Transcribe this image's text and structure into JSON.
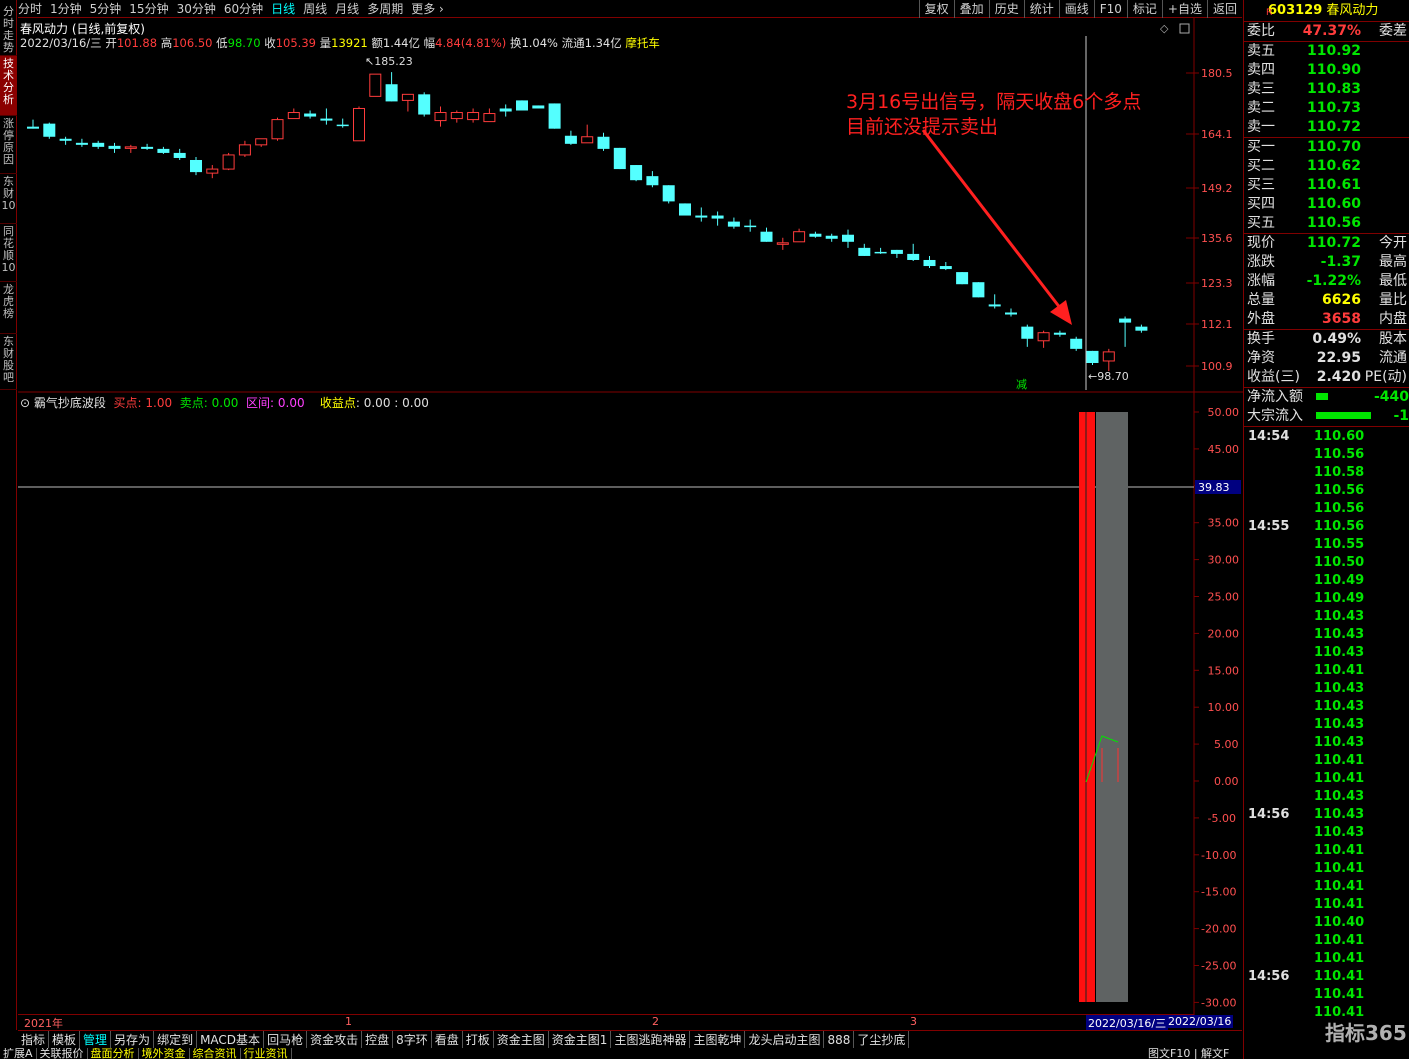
{
  "left_tabs": [
    "分时走势",
    "技术分析",
    "涨停原因",
    "东财10",
    "同花顺10",
    "龙虎榜",
    "东财股吧"
  ],
  "top_periods": [
    "分时",
    "1分钟",
    "5分钟",
    "15分钟",
    "30分钟",
    "60分钟",
    "日线",
    "周线",
    "月线",
    "多周期",
    "更多"
  ],
  "active_period": "日线",
  "top_buttons": [
    "复权",
    "叠加",
    "历史",
    "统计",
    "画线",
    "F10",
    "标记",
    "+自选",
    "返回"
  ],
  "chart_title": "春风动力 (日线,前复权)",
  "ohlc": {
    "date": "2022/03/16/三",
    "open_l": "开",
    "open": "101.88",
    "high_l": "高",
    "high": "106.50",
    "low_l": "低",
    "low": "98.70",
    "close_l": "收",
    "close": "105.39",
    "vol_l": "量",
    "vol": "13921",
    "amt_l": "额",
    "amt": "1.44亿",
    "chg_l": "幅",
    "chg": "4.84(4.81%)",
    "turn_l": "换",
    "turn": "1.04%",
    "float_l": "流通",
    "float": "1.34亿",
    "tag": "摩托车"
  },
  "price_axis": [
    "180.5",
    "164.1",
    "149.2",
    "135.6",
    "123.3",
    "112.1",
    "100.9"
  ],
  "max_label": "185.23",
  "min_label": "98.70",
  "jian": "减",
  "annotation": {
    "line1": "3月16号出信号，隔天收盘6个多点",
    "line2": "目前还没提示卖出"
  },
  "indicator": {
    "name": "霸气抄底波段",
    "buy_l": "买点",
    "buy": "1.00",
    "sell_l": "卖点",
    "sell": "0.00",
    "range_l": "区间",
    "range": "0.00",
    "profit_l": "收益点",
    "profit": "0.00 : 0.00"
  },
  "ind_axis": [
    "50.00",
    "45.00",
    "40.00",
    "35.00",
    "30.00",
    "25.00",
    "20.00",
    "15.00",
    "10.00",
    "5.00",
    "0.00",
    "-5.00",
    "-10.00",
    "-15.00",
    "-20.00",
    "-25.00",
    "-30.00"
  ],
  "ind_crosshair_value": "39.83",
  "time_axis": {
    "year": "2021年",
    "m1": "1",
    "m2": "2",
    "m3": "3",
    "date1": "2022/03/16/三",
    "date2": "2022/03/16"
  },
  "bottom_tabs": [
    "指标",
    "模板",
    "管理",
    "另存为",
    "绑定到",
    "MACD基本",
    "回马枪",
    "资金攻击",
    "控盘",
    "8字环",
    "看盘",
    "打板",
    "资金主图",
    "资金主图1",
    "主图逃跑神器",
    "主图乾坤",
    "龙头启动主图",
    "888",
    "了尘抄底"
  ],
  "bottom_tabs2": [
    "扩展A",
    "关联报价",
    "盘面分析",
    "境外资金",
    "综合资讯",
    "行业资讯"
  ],
  "bottom_right": "图文F10 | 解文F",
  "stock": {
    "code": "603129",
    "name": "春风动力",
    "badge": "R"
  },
  "quote": {
    "wb_l": "委比",
    "wb": "47.37%",
    "wc_l": "委差",
    "asks": [
      {
        "l": "卖五",
        "p": "110.92"
      },
      {
        "l": "卖四",
        "p": "110.90"
      },
      {
        "l": "卖三",
        "p": "110.83"
      },
      {
        "l": "卖二",
        "p": "110.73"
      },
      {
        "l": "卖一",
        "p": "110.72"
      }
    ],
    "bids": [
      {
        "l": "买一",
        "p": "110.70"
      },
      {
        "l": "买二",
        "p": "110.62"
      },
      {
        "l": "买三",
        "p": "110.61"
      },
      {
        "l": "买四",
        "p": "110.60"
      },
      {
        "l": "买五",
        "p": "110.56"
      }
    ],
    "stats": [
      {
        "l": "现价",
        "v": "110.72",
        "r": "今开",
        "c": "#00e600"
      },
      {
        "l": "涨跌",
        "v": "-1.37",
        "r": "最高",
        "c": "#00e600"
      },
      {
        "l": "涨幅",
        "v": "-1.22%",
        "r": "最低",
        "c": "#00e600"
      },
      {
        "l": "总量",
        "v": "6626",
        "r": "量比",
        "c": "#ffff00"
      },
      {
        "l": "外盘",
        "v": "3658",
        "r": "内盘",
        "c": "#ff3c3c"
      }
    ],
    "stats2": [
      {
        "l": "换手",
        "v": "0.49%",
        "r": "股本"
      },
      {
        "l": "净资",
        "v": "22.95",
        "r": "流通"
      },
      {
        "l": "收益(三)",
        "v": "2.420",
        "r": "PE(动)"
      }
    ],
    "flows": [
      {
        "l": "净流入额",
        "v": "-440"
      },
      {
        "l": "大宗流入",
        "v": "-1"
      }
    ]
  },
  "ticks": [
    {
      "t": "14:54",
      "p": "110.60"
    },
    {
      "t": "",
      "p": "110.56"
    },
    {
      "t": "",
      "p": "110.58"
    },
    {
      "t": "",
      "p": "110.56"
    },
    {
      "t": "",
      "p": "110.56"
    },
    {
      "t": "14:55",
      "p": "110.56"
    },
    {
      "t": "",
      "p": "110.55"
    },
    {
      "t": "",
      "p": "110.50"
    },
    {
      "t": "",
      "p": "110.49"
    },
    {
      "t": "",
      "p": "110.49"
    },
    {
      "t": "",
      "p": "110.43"
    },
    {
      "t": "",
      "p": "110.43"
    },
    {
      "t": "",
      "p": "110.43"
    },
    {
      "t": "",
      "p": "110.41"
    },
    {
      "t": "",
      "p": "110.43"
    },
    {
      "t": "",
      "p": "110.43"
    },
    {
      "t": "",
      "p": "110.43"
    },
    {
      "t": "",
      "p": "110.43"
    },
    {
      "t": "",
      "p": "110.41"
    },
    {
      "t": "",
      "p": "110.41"
    },
    {
      "t": "",
      "p": "110.43"
    },
    {
      "t": "14:56",
      "p": "110.43"
    },
    {
      "t": "",
      "p": "110.43"
    },
    {
      "t": "",
      "p": "110.41"
    },
    {
      "t": "",
      "p": "110.41"
    },
    {
      "t": "",
      "p": "110.41"
    },
    {
      "t": "",
      "p": "110.41"
    },
    {
      "t": "",
      "p": "110.40"
    },
    {
      "t": "",
      "p": "110.41"
    },
    {
      "t": "",
      "p": "110.41"
    },
    {
      "t": "14:56",
      "p": "110.41"
    },
    {
      "t": "",
      "p": "110.41"
    },
    {
      "t": "",
      "p": "110.41"
    }
  ],
  "watermark": "指标365",
  "chart_data": {
    "type": "candlestick",
    "candles": [
      {
        "o": 137,
        "h": 140.5,
        "l": 136.5,
        "c": 136,
        "k": 0
      },
      {
        "o": 138.5,
        "h": 139,
        "l": 131,
        "c": 132,
        "k": 0
      },
      {
        "o": 130,
        "h": 132,
        "l": 128,
        "c": 131,
        "k": 0
      },
      {
        "o": 129,
        "h": 131,
        "l": 127,
        "c": 128,
        "k": 0
      },
      {
        "o": 129,
        "h": 130,
        "l": 126,
        "c": 127,
        "k": 0
      },
      {
        "o": 127.5,
        "h": 129,
        "l": 124,
        "c": 126,
        "k": 0
      },
      {
        "o": 126.5,
        "h": 128,
        "l": 124,
        "c": 127,
        "k": 1
      },
      {
        "o": 127,
        "h": 128.5,
        "l": 125.5,
        "c": 126,
        "k": 0
      },
      {
        "o": 126,
        "h": 127,
        "l": 123.5,
        "c": 124,
        "k": 0
      },
      {
        "o": 124,
        "h": 126,
        "l": 120.5,
        "c": 121.5,
        "k": 0
      },
      {
        "o": 120.5,
        "h": 122,
        "l": 113,
        "c": 114.5,
        "k": 0
      },
      {
        "o": 114,
        "h": 118,
        "l": 111.5,
        "c": 116,
        "k": 1
      },
      {
        "o": 116,
        "h": 124,
        "l": 115.5,
        "c": 123,
        "k": 1
      },
      {
        "o": 123,
        "h": 130,
        "l": 122,
        "c": 128,
        "k": 1
      },
      {
        "o": 128,
        "h": 131,
        "l": 127,
        "c": 131,
        "k": 1
      },
      {
        "o": 131,
        "h": 141.5,
        "l": 130,
        "c": 140.5,
        "k": 1
      },
      {
        "o": 141,
        "h": 146,
        "l": 141.5,
        "c": 144,
        "k": 1
      },
      {
        "o": 143.5,
        "h": 145,
        "l": 141,
        "c": 142,
        "k": 0
      },
      {
        "o": 141,
        "h": 146,
        "l": 138,
        "c": 140,
        "k": 0
      },
      {
        "o": 138,
        "h": 141,
        "l": 136.5,
        "c": 138,
        "k": 0
      },
      {
        "o": 130,
        "h": 147,
        "l": 130,
        "c": 146,
        "k": 1
      },
      {
        "o": 152,
        "h": 163,
        "l": 152.5,
        "c": 163,
        "k": 1
      },
      {
        "o": 158,
        "h": 164,
        "l": 150,
        "c": 149.5,
        "k": 0
      },
      {
        "o": 150,
        "h": 152,
        "l": 144.5,
        "c": 153,
        "k": 1
      },
      {
        "o": 153,
        "h": 154,
        "l": 142,
        "c": 143,
        "k": 0
      },
      {
        "o": 140,
        "h": 147,
        "l": 137,
        "c": 144,
        "k": 1
      },
      {
        "o": 141,
        "h": 145,
        "l": 139,
        "c": 144,
        "k": 1
      },
      {
        "o": 144,
        "h": 146,
        "l": 139,
        "c": 140.5,
        "k": 1
      },
      {
        "o": 139.5,
        "h": 146,
        "l": 140,
        "c": 143.5,
        "k": 1
      },
      {
        "o": 146,
        "h": 148,
        "l": 142,
        "c": 144.5,
        "k": 0
      },
      {
        "o": 145,
        "h": 149,
        "l": 145,
        "c": 150,
        "k": 0
      },
      {
        "o": 146,
        "h": 147,
        "l": 147.5,
        "c": 147.5,
        "k": 0
      },
      {
        "o": 148.5,
        "h": 148.5,
        "l": 136,
        "c": 136,
        "k": 0
      },
      {
        "o": 132.5,
        "h": 135,
        "l": 128,
        "c": 128.5,
        "k": 0
      },
      {
        "o": 129,
        "h": 138,
        "l": 129,
        "c": 132,
        "k": 1
      },
      {
        "o": 132,
        "h": 134,
        "l": 125,
        "c": 126,
        "k": 0
      },
      {
        "o": 126.5,
        "h": 126.5,
        "l": 116,
        "c": 116,
        "k": 0
      },
      {
        "o": 118,
        "h": 118,
        "l": 110,
        "c": 110.5,
        "k": 0
      },
      {
        "o": 112.5,
        "h": 115,
        "l": 107,
        "c": 108,
        "k": 0
      },
      {
        "o": 108,
        "h": 108,
        "l": 99,
        "c": 100,
        "k": 0
      },
      {
        "o": 99,
        "h": 99,
        "l": 93,
        "c": 93,
        "k": 0
      },
      {
        "o": 93,
        "h": 97,
        "l": 90,
        "c": 92,
        "k": 0
      },
      {
        "o": 93,
        "h": 95,
        "l": 88,
        "c": 91.5,
        "k": 0
      },
      {
        "o": 90,
        "h": 92,
        "l": 86.5,
        "c": 87.5,
        "k": 0
      },
      {
        "o": 88,
        "h": 91,
        "l": 85,
        "c": 88,
        "k": 0
      },
      {
        "o": 85,
        "h": 87,
        "l": 80,
        "c": 80,
        "k": 0
      },
      {
        "o": 79.5,
        "h": 82,
        "l": 76,
        "c": 79.5,
        "k": 1
      },
      {
        "o": 80,
        "h": 86.5,
        "l": 80,
        "c": 85,
        "k": 1
      },
      {
        "o": 84,
        "h": 85,
        "l": 82,
        "c": 82.5,
        "k": 0
      },
      {
        "o": 83,
        "h": 84,
        "l": 80,
        "c": 81.5,
        "k": 0
      },
      {
        "o": 83.5,
        "h": 86,
        "l": 77,
        "c": 80,
        "k": 0
      },
      {
        "o": 77,
        "h": 79,
        "l": 73,
        "c": 73,
        "k": 0
      },
      {
        "o": 75,
        "h": 77,
        "l": 74,
        "c": 75,
        "k": 0
      },
      {
        "o": 76,
        "h": 76,
        "l": 72,
        "c": 74,
        "k": 0
      },
      {
        "o": 74,
        "h": 79,
        "l": 70.5,
        "c": 71,
        "k": 0
      },
      {
        "o": 71,
        "h": 73,
        "l": 67,
        "c": 68,
        "k": 0
      },
      {
        "o": 68,
        "h": 70,
        "l": 66,
        "c": 66.5,
        "k": 0
      },
      {
        "o": 65,
        "h": 65,
        "l": 59,
        "c": 59,
        "k": 0
      },
      {
        "o": 60,
        "h": 60,
        "l": 52.5,
        "c": 52.5,
        "k": 0
      },
      {
        "o": 49,
        "h": 54,
        "l": 47,
        "c": 48,
        "k": 0
      },
      {
        "o": 44,
        "h": 47,
        "l": 43,
        "c": 45,
        "k": 0
      },
      {
        "o": 38,
        "h": 39,
        "l": 28,
        "c": 32,
        "k": 0
      },
      {
        "o": 31,
        "h": 36,
        "l": 27.5,
        "c": 35,
        "k": 1
      },
      {
        "o": 35,
        "h": 36,
        "l": 33,
        "c": 34,
        "k": 0
      },
      {
        "o": 32,
        "h": 33,
        "l": 26,
        "c": 27,
        "k": 0
      },
      {
        "o": 26,
        "h": 26,
        "l": 19,
        "c": 20,
        "k": 0
      },
      {
        "o": 21,
        "h": 27,
        "l": 16,
        "c": 25.5,
        "k": 1
      },
      {
        "o": 40,
        "h": 43,
        "l": 28,
        "c": 42,
        "k": 0
      },
      {
        "o": 38,
        "h": 39,
        "l": 35,
        "c": 36,
        "k": 0
      }
    ]
  }
}
